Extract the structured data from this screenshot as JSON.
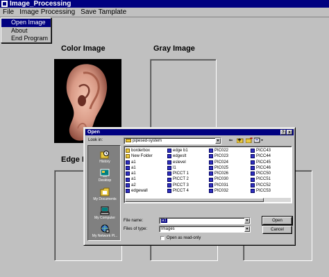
{
  "window": {
    "title": "Image_Processing"
  },
  "menu": {
    "items": [
      "File",
      "Image Processing",
      "Save Tamplate"
    ],
    "file_items": [
      "Open Image",
      "About",
      "End Program"
    ]
  },
  "captions": {
    "color": "Color Image",
    "gray": "Gray Image",
    "edge": "Edge I"
  },
  "dialog": {
    "title": "Open",
    "look_in_label": "Look in:",
    "look_in_value": "pipesed-system",
    "places": [
      "History",
      "Desktop",
      "My Documents",
      "My Computer",
      "My Network Pl..."
    ],
    "files": [
      [
        "borderbox",
        "New Folder",
        "a1",
        "a1",
        "a1",
        "a1",
        "a2",
        "edgewall"
      ],
      [
        "edge b1",
        "edgeslt",
        "eslevel",
        "l1",
        "PICCT 1",
        "PICCT 2",
        "PICCT 3",
        "PICCT 4"
      ],
      [
        "PIC022",
        "PIC023",
        "PIC024",
        "PIC025",
        "PIC026",
        "PIC030",
        "PIC031",
        "PIC032"
      ],
      [
        "PICC43",
        "PICC44",
        "PICC45",
        "PICC46",
        "PICC50",
        "PICC51",
        "PICC52",
        "PICC53"
      ]
    ],
    "file_name_label": "File name:",
    "file_name_value": "a1",
    "file_type_label": "Files of type:",
    "file_type_value": "Images",
    "open_button": "Open",
    "cancel_button": "Cancel",
    "readonly_label": "Open as read-only",
    "help_button": "?",
    "close_button": "x"
  }
}
